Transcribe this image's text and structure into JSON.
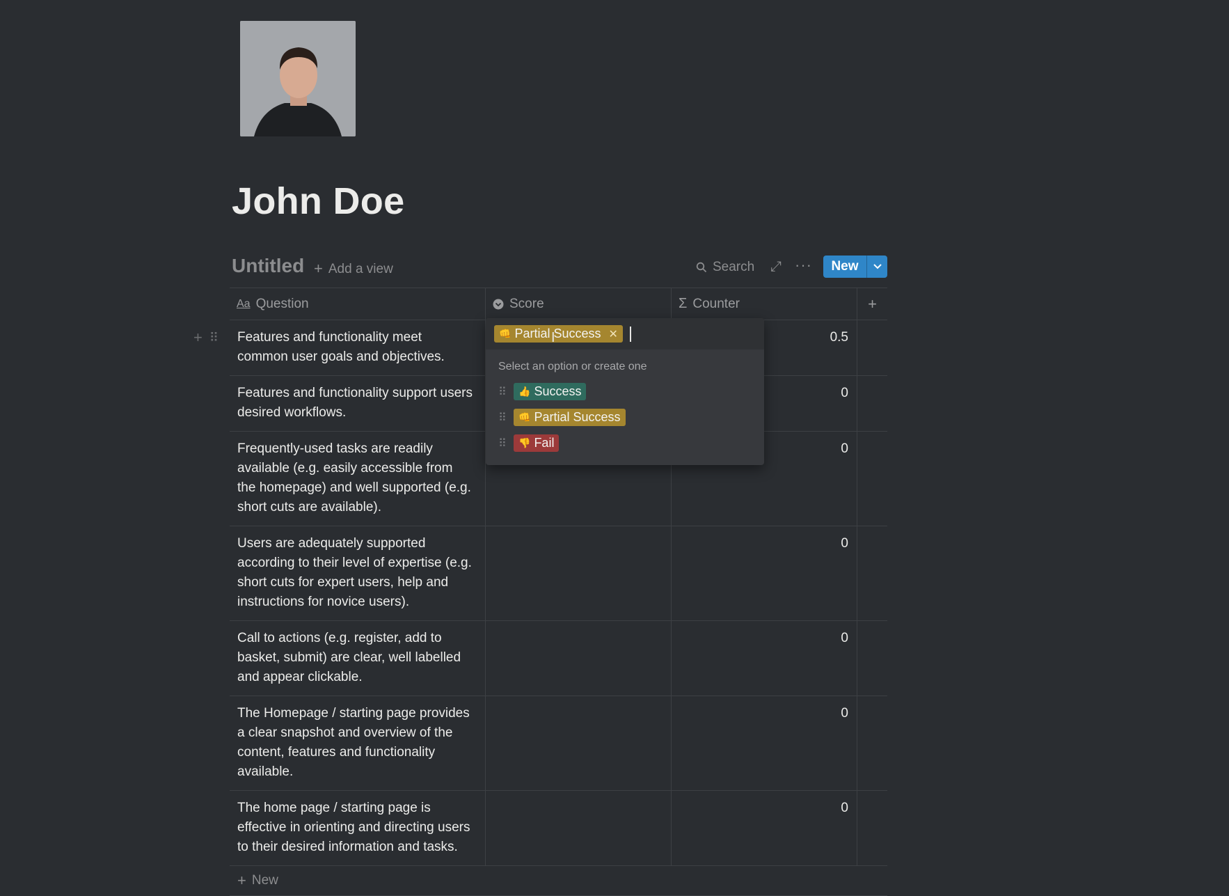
{
  "page": {
    "title": "John Doe",
    "photo_alt": "profile-photo"
  },
  "database": {
    "title": "Untitled",
    "add_view_label": "Add a view",
    "search_label": "Search",
    "new_label": "New"
  },
  "columns": [
    {
      "name": "Question",
      "icon": "text-aa-icon"
    },
    {
      "name": "Score",
      "icon": "select-chevron-icon"
    },
    {
      "name": "Counter",
      "icon": "sigma-icon"
    }
  ],
  "rows": [
    {
      "question": "Features and functionality meet common user goals and objectives.",
      "counter": "0.5"
    },
    {
      "question": "Features and functionality support users desired workflows.",
      "counter": "0"
    },
    {
      "question": "Frequently-used tasks are readily available (e.g. easily accessible from the homepage) and well supported (e.g. short cuts are available).",
      "counter": "0"
    },
    {
      "question": "Users are adequately supported according to their level of expertise (e.g. short cuts for expert users, help and instructions for novice users).",
      "counter": "0"
    },
    {
      "question": "Call to actions (e.g. register, add to basket, submit) are clear, well labelled and appear clickable.",
      "counter": "0"
    },
    {
      "question": "The Homepage / starting page provides a clear snapshot and overview of the content, features and functionality available.",
      "counter": "0"
    },
    {
      "question": "The home page / starting page is effective in orienting and directing users to their desired information and tasks.",
      "counter": "0"
    }
  ],
  "new_row_label": "New",
  "dropdown": {
    "selected": {
      "label": "Partial Success",
      "emoji": "👊"
    },
    "hint": "Select an option or create one",
    "options": [
      {
        "label": "Success",
        "emoji": "👍",
        "color": "#2f6b5e"
      },
      {
        "label": "Partial Success",
        "emoji": "👊",
        "color": "#a5862f"
      },
      {
        "label": "Fail",
        "emoji": "👎",
        "color": "#9c3a3a"
      }
    ]
  },
  "colors": {
    "background": "#2a2d31",
    "accent": "#2f86c8"
  }
}
